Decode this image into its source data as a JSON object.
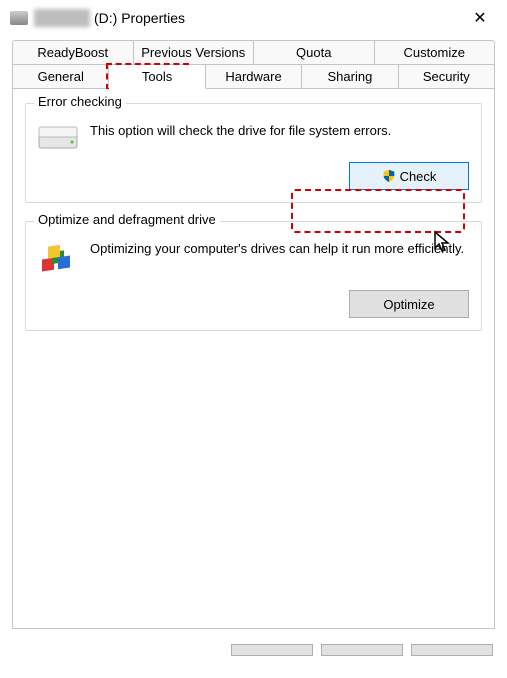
{
  "window": {
    "title_suffix": "(D:) Properties",
    "close_glyph": "✕"
  },
  "tabs": {
    "row1": [
      "ReadyBoost",
      "Previous Versions",
      "Quota",
      "Customize"
    ],
    "row2": [
      "General",
      "Tools",
      "Hardware",
      "Sharing",
      "Security"
    ],
    "active": "Tools"
  },
  "groups": {
    "error_checking": {
      "title": "Error checking",
      "desc": "This option will check the drive for file system errors.",
      "button": "Check"
    },
    "defrag": {
      "title": "Optimize and defragment drive",
      "desc": "Optimizing your computer's drives can help it run more efficiently.",
      "button": "Optimize"
    }
  },
  "colors": {
    "highlight": "#d40000",
    "accent": "#0078d7"
  }
}
